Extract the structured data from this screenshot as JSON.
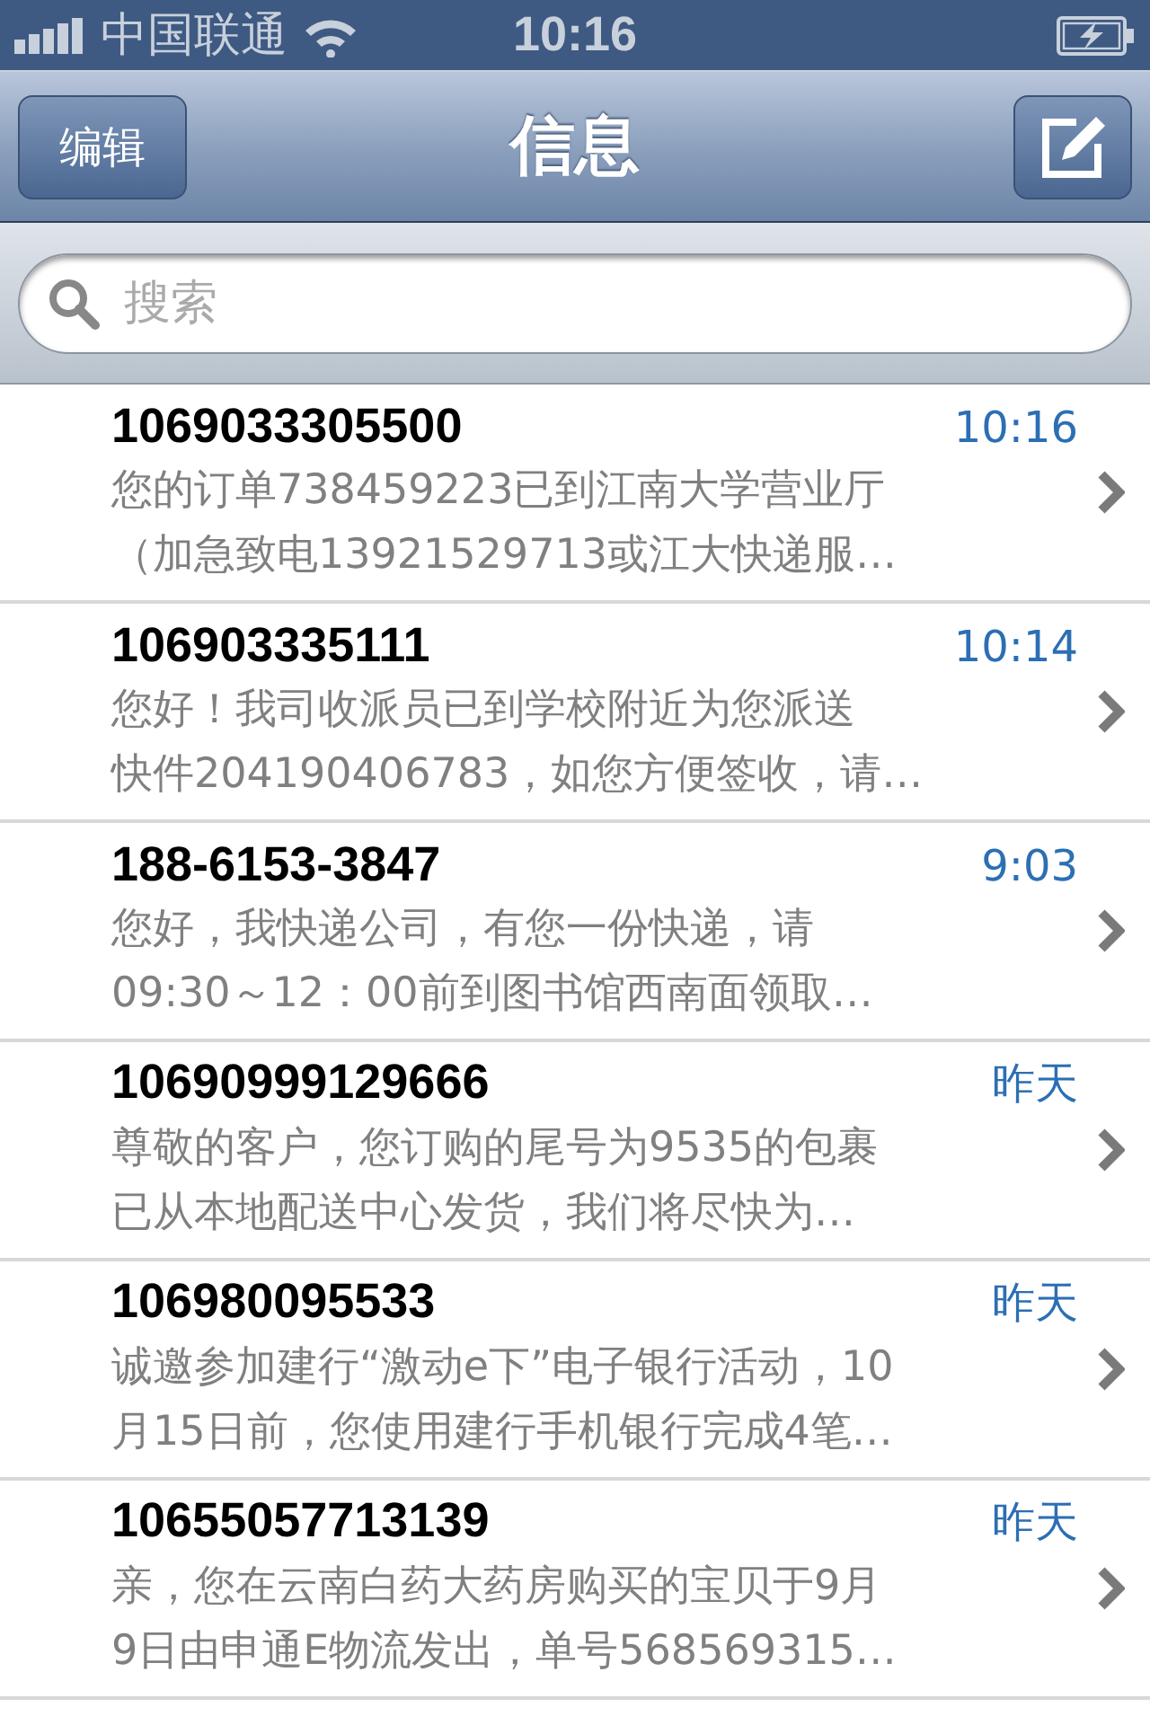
{
  "status_bar": {
    "carrier": "中国联通",
    "time": "10:16"
  },
  "nav_bar": {
    "left_button": "编辑",
    "title": "信息"
  },
  "search": {
    "placeholder": "搜索"
  },
  "messages": [
    {
      "sender": "1069033305500",
      "time": "10:16",
      "preview_lines": [
        "您的订单738459223已到江南大学营业厅",
        "（加急致电13921529713或江大快递服…"
      ]
    },
    {
      "sender": "106903335111",
      "time": "10:14",
      "preview_lines": [
        "您好！我司收派员已到学校附近为您派送",
        "快件204190406783，如您方便签收，请…"
      ]
    },
    {
      "sender": "188-6153-3847",
      "time": "9:03",
      "preview_lines": [
        "您好，我快递公司，有您一份快递，请",
        "09:30～12：00前到图书馆西南面领取…"
      ]
    },
    {
      "sender": "10690999129666",
      "time": "昨天",
      "preview_lines": [
        "尊敬的客户，您订购的尾号为9535的包裹",
        "已从本地配送中心发货，我们将尽快为…"
      ]
    },
    {
      "sender": "106980095533",
      "time": "昨天",
      "preview_lines": [
        "诚邀参加建行“激动e下”电子银行活动，10",
        "月15日前，您使用建行手机银行完成4笔…"
      ]
    },
    {
      "sender": "10655057713139",
      "time": "昨天",
      "preview_lines": [
        "亲，您在云南白药大药房购买的宝贝于9月",
        "9日由申通E物流发出，单号568569315…"
      ]
    }
  ]
}
